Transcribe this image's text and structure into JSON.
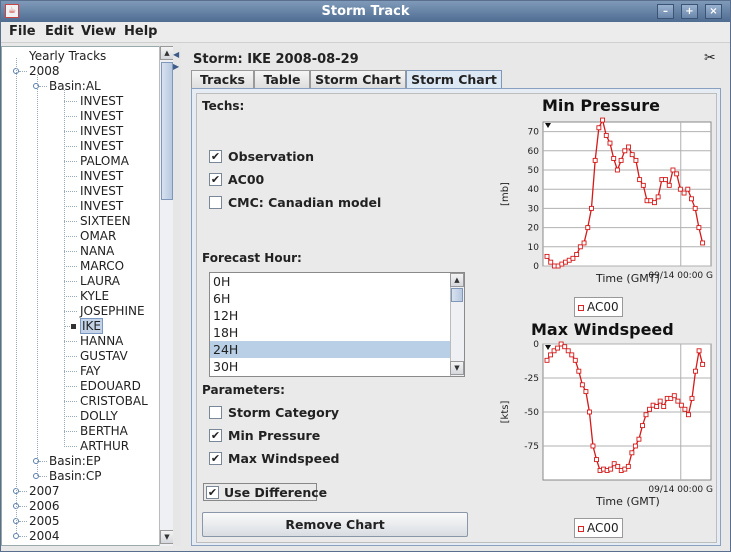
{
  "window": {
    "title": "Storm Track",
    "app_icon": "java-icon"
  },
  "menu": [
    {
      "label": "File",
      "accel": "F"
    },
    {
      "label": "Edit",
      "accel": "E"
    },
    {
      "label": "View",
      "accel": "V"
    },
    {
      "label": "Help",
      "accel": "H"
    }
  ],
  "tree": {
    "root": "Yearly Tracks",
    "year_open": "2008",
    "basin_open": "Basin:AL",
    "storms": [
      "INVEST",
      "INVEST",
      "INVEST",
      "INVEST",
      "PALOMA",
      "INVEST",
      "INVEST",
      "INVEST",
      "SIXTEEN",
      "OMAR",
      "NANA",
      "MARCO",
      "LAURA",
      "KYLE",
      "JOSEPHINE",
      "IKE",
      "HANNA",
      "GUSTAV",
      "FAY",
      "EDOUARD",
      "CRISTOBAL",
      "DOLLY",
      "BERTHA",
      "ARTHUR"
    ],
    "selected_storm": "IKE",
    "other_basins": [
      "Basin:EP",
      "Basin:CP"
    ],
    "other_years": [
      "2007",
      "2006",
      "2005",
      "2004"
    ]
  },
  "storm_header": "Storm: IKE   2008-08-29",
  "tabs": [
    "Tracks",
    "Table",
    "Storm Chart",
    "Storm Chart"
  ],
  "active_tab": 3,
  "techs": {
    "label": "Techs:",
    "items": [
      {
        "label": "Observation",
        "checked": true,
        "mark": "✔"
      },
      {
        "label": "AC00",
        "checked": true,
        "mark": "✔"
      },
      {
        "label": "CMC: Canadian model",
        "checked": false,
        "mark": ""
      }
    ]
  },
  "forecast": {
    "label": "Forecast Hour:",
    "hours": [
      "0H",
      "6H",
      "12H",
      "18H",
      "24H",
      "30H"
    ],
    "selected": "24H"
  },
  "parameters": {
    "label": "Parameters:",
    "items": [
      {
        "label": "Storm Category",
        "checked": false,
        "mark": ""
      },
      {
        "label": "Min Pressure",
        "checked": true,
        "mark": "✔"
      },
      {
        "label": "Max Windspeed",
        "checked": true,
        "mark": "✔"
      }
    ]
  },
  "use_difference": {
    "label": "Use Difference",
    "checked": true,
    "mark": "✔"
  },
  "remove_button": "Remove Chart",
  "colors": {
    "series": "#d41a1a",
    "accent": "#7f97b8"
  },
  "chart_data": [
    {
      "type": "line",
      "title": "Min Pressure",
      "ylabel": "[mb]",
      "xlabel": "Time (GMT)",
      "ylim": [
        0,
        75
      ],
      "yticks": [
        0,
        10,
        20,
        30,
        40,
        50,
        60,
        70
      ],
      "x_tick_label": "09/14 00:00 G",
      "grid": true,
      "legend": "bottom",
      "series": [
        {
          "name": "AC00",
          "values": [
            5,
            2,
            0,
            0,
            1,
            2,
            3,
            4,
            6,
            10,
            12,
            20,
            30,
            55,
            72,
            76,
            68,
            64,
            56,
            50,
            55,
            60,
            62,
            58,
            55,
            45,
            42,
            34,
            34,
            33,
            36,
            45,
            45,
            42,
            50,
            48,
            40,
            38,
            40,
            35,
            30,
            20,
            12
          ]
        }
      ]
    },
    {
      "type": "line",
      "title": "Max Windspeed",
      "ylabel": "[kts]",
      "xlabel": "Time (GMT)",
      "ylim": [
        -100,
        0
      ],
      "yticks": [
        0,
        -25,
        -50,
        -75
      ],
      "x_tick_label": "09/14 00:00 G",
      "grid": true,
      "legend": "bottom",
      "series": [
        {
          "name": "AC00",
          "values": [
            -12,
            -8,
            -5,
            -3,
            0,
            -2,
            -5,
            -8,
            -12,
            -20,
            -30,
            -35,
            -50,
            -75,
            -85,
            -93,
            -92,
            -93,
            -92,
            -88,
            -90,
            -93,
            -92,
            -90,
            -80,
            -75,
            -70,
            -60,
            -52,
            -48,
            -45,
            -46,
            -42,
            -46,
            -40,
            -40,
            -38,
            -42,
            -45,
            -48,
            -52,
            -40,
            -20,
            -5,
            -15
          ]
        }
      ]
    }
  ]
}
